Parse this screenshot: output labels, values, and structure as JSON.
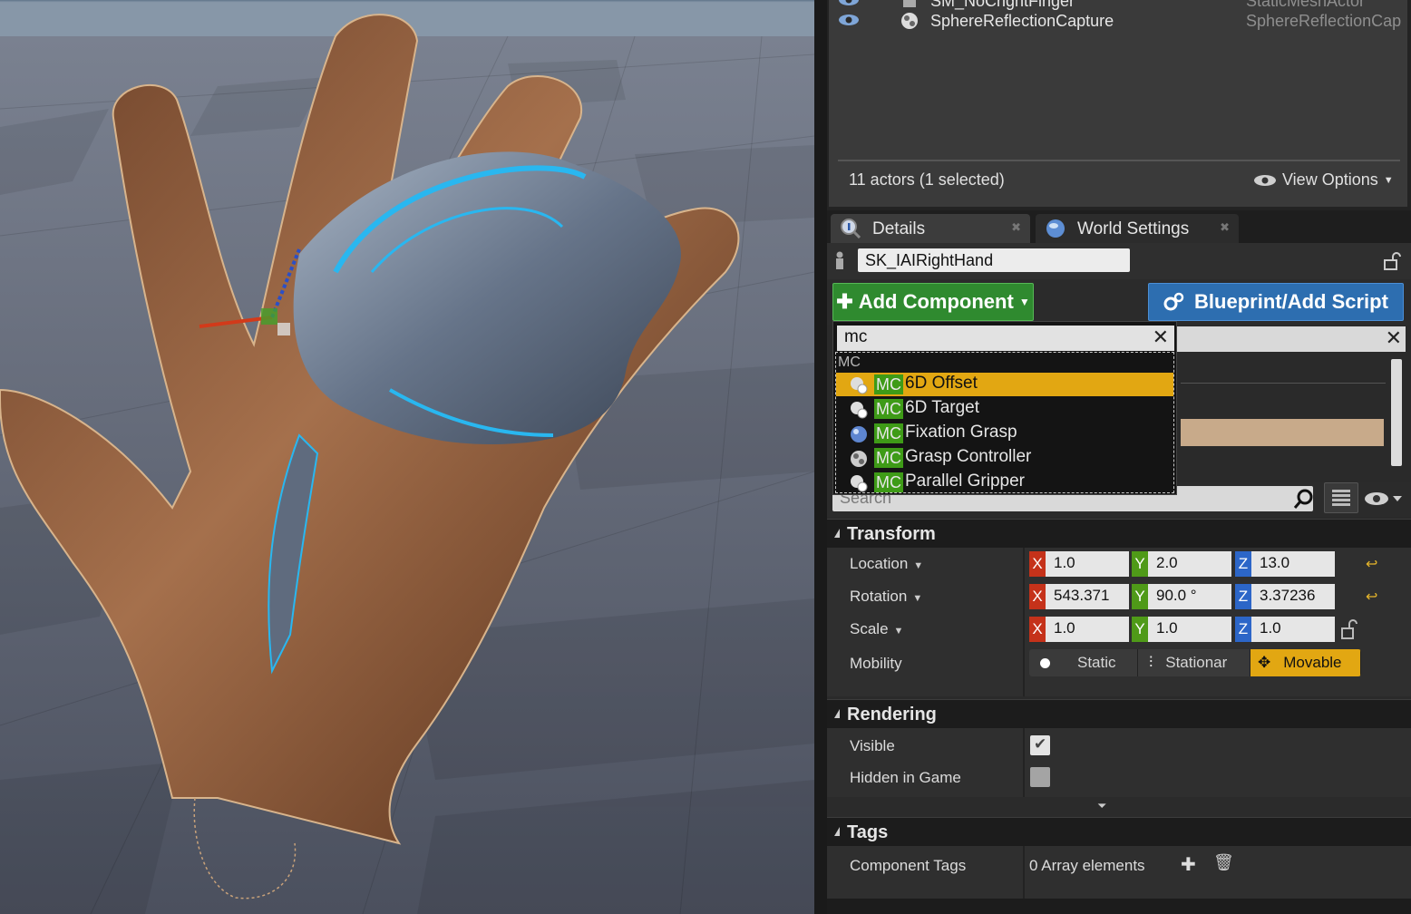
{
  "outliner": {
    "rows": [
      {
        "label": "SM_NoCrightFinger",
        "type": "StaticMeshActor"
      },
      {
        "label": "SphereReflectionCapture",
        "type": "SphereReflectionCap"
      }
    ],
    "actor_count": "11 actors (1 selected)",
    "view_options": "View Options"
  },
  "tabs": [
    {
      "label": "Details",
      "icon": "magnifier-info-icon"
    },
    {
      "label": "World Settings",
      "icon": "globe-icon"
    }
  ],
  "details": {
    "actor_name": "SK_IAIRightHand",
    "add_component_label": "Add Component",
    "blueprint_label": "Blueprint/Add Script",
    "search_placeholder": "Search",
    "categories": {
      "transform": "Transform",
      "rendering": "Rendering",
      "tags": "Tags"
    },
    "transform": {
      "location_label": "Location",
      "rotation_label": "Rotation",
      "scale_label": "Scale",
      "mobility_label": "Mobility",
      "axis_x": "X",
      "axis_y": "Y",
      "axis_z": "Z",
      "location": [
        "1.0",
        "2.0",
        "13.0"
      ],
      "rotation": [
        "543.371",
        "90.0 °",
        "3.37236"
      ],
      "scale": [
        "1.0",
        "1.0",
        "1.0"
      ],
      "mobility_options": [
        "Static",
        "Stationar",
        "Movable"
      ],
      "mobility_selected": "Movable"
    },
    "rendering": {
      "visible_label": "Visible",
      "visible": true,
      "hidden_label": "Hidden in Game",
      "hidden": false
    },
    "tags": {
      "component_tags_label": "Component Tags",
      "array_text": "0 Array elements"
    }
  },
  "popup": {
    "search_value": "mc",
    "category": "MC",
    "tag": "MC",
    "items": [
      "6D Offset",
      "6D Target",
      "Fixation Grasp",
      "Grasp Controller",
      "Parallel Gripper"
    ],
    "selected": "6D Offset"
  },
  "colors": {
    "accent_orange": "#e2a712",
    "add_green": "#2f8a2f",
    "blueprint_blue": "#2d6eb0",
    "axis_x": "#c5321a",
    "axis_y": "#4f9a18",
    "axis_z": "#2c66c8"
  }
}
